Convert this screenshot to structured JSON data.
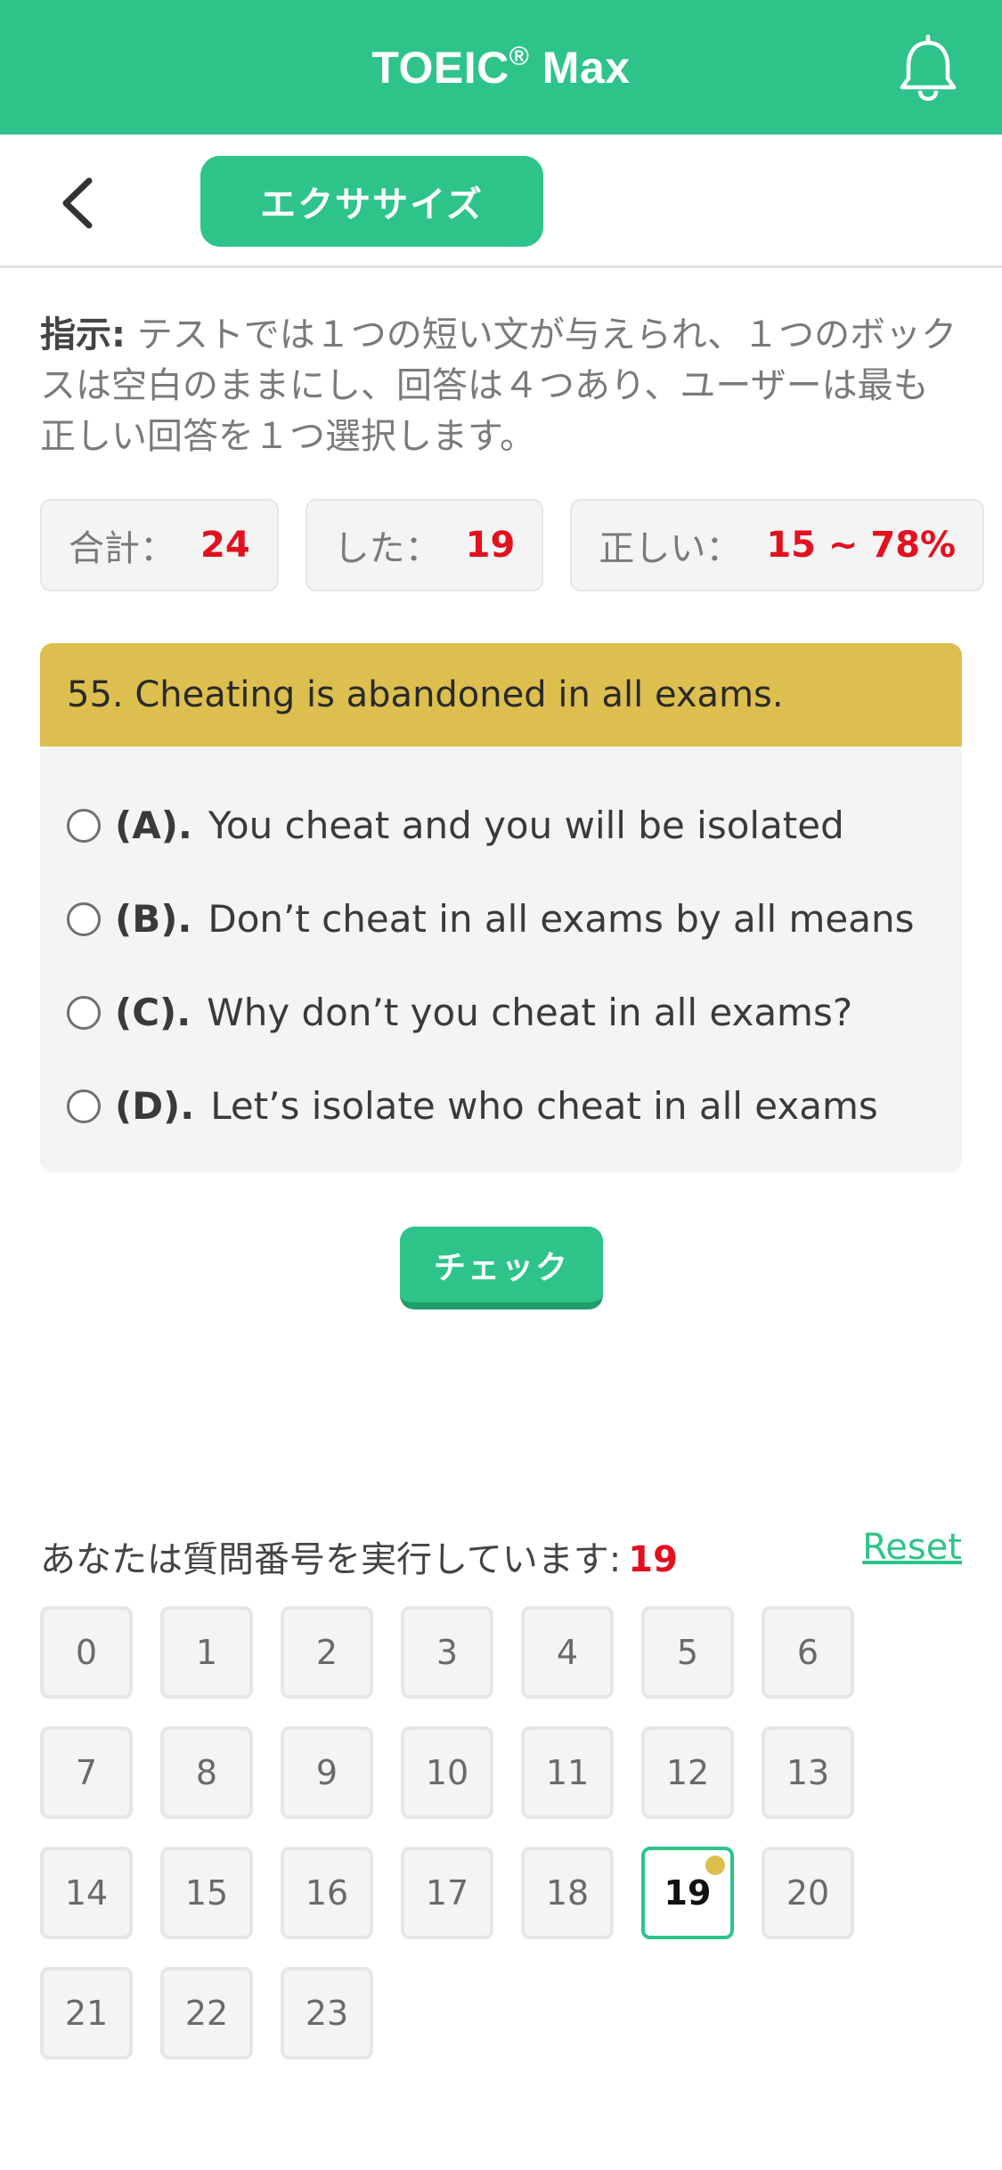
{
  "app_bar": {
    "title": "TOEIC",
    "title_mark": "®",
    "title_suffix": " Max",
    "notification_icon": "bell-icon",
    "color": "#2ec489"
  },
  "subbar": {
    "back_icon": "chevron-left-icon",
    "tab_label": "エクササイズ"
  },
  "instructions": {
    "label": "指示:",
    "text": " テストでは１つの短い文が与えられ、１つのボックスは空白のままにし、回答は４つあり、ユーザーは最も正しい回答を１つ選択します。"
  },
  "stats": {
    "total_label": "合計：",
    "total_value": "24",
    "done_label": "した：",
    "done_value": "19",
    "correct_label": "正しい：",
    "correct_value": "15 ~ 78%"
  },
  "question": {
    "text": "55. Cheating is abandoned in all exams.",
    "options": [
      {
        "key": "(A).",
        "text": "You cheat and you will be isolated"
      },
      {
        "key": "(B).",
        "text": "Don’t cheat in all exams by all means"
      },
      {
        "key": "(C).",
        "text": "Why don’t you cheat in all exams?"
      },
      {
        "key": "(D).",
        "text": "Let’s isolate who cheat in all exams"
      }
    ]
  },
  "check_button": "チェック",
  "progress": {
    "label": "あなたは質問番号を実行しています:",
    "current": "19",
    "reset": "Reset",
    "numbers": [
      "0",
      "1",
      "2",
      "3",
      "4",
      "5",
      "6",
      "7",
      "8",
      "9",
      "10",
      "11",
      "12",
      "13",
      "14",
      "15",
      "16",
      "17",
      "18",
      "19",
      "20",
      "21",
      "22",
      "23"
    ],
    "active_index": 19
  },
  "colors": {
    "accent": "#2ec489",
    "question_header": "#dcbf4e",
    "highlight_red": "#e3101e"
  }
}
